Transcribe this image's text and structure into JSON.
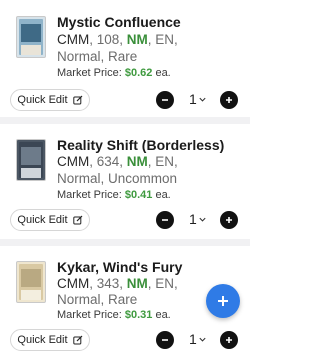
{
  "items": [
    {
      "name": "Mystic Confluence",
      "set": "CMM",
      "number": ", 108, ",
      "condition": "NM",
      "details1_tail": ", EN,",
      "details2": "Normal, Rare",
      "price_label": "Market Price: ",
      "price_value": "$0.62",
      "price_unit": " ea.",
      "quick_edit": "Quick Edit",
      "qty": "1",
      "thumb": {
        "frame": "#8fb3c9",
        "art": "#3f6a86"
      }
    },
    {
      "name": "Reality Shift (Borderless)",
      "set": "CMM",
      "number": ", 634, ",
      "condition": "NM",
      "details1_tail": ", EN,",
      "details2": "Normal, Uncommon",
      "price_label": "Market Price: ",
      "price_value": "$0.41",
      "price_unit": " ea.",
      "quick_edit": "Quick Edit",
      "qty": "1",
      "thumb": {
        "frame": "#3b4654",
        "art": "#6d7b8a"
      }
    },
    {
      "name": "Kykar, Wind's Fury",
      "set": "CMM",
      "number": ", 343, ",
      "condition": "NM",
      "details1_tail": ", EN,",
      "details2": "Normal, Rare",
      "price_label": "Market Price: ",
      "price_value": "$0.31",
      "price_unit": " ea.",
      "quick_edit": "Quick Edit",
      "qty": "1",
      "thumb": {
        "frame": "#d9c9a3",
        "art": "#b9a982"
      }
    }
  ],
  "icons": {
    "edit": "pencil-square-icon",
    "minus": "minus-circle-icon",
    "plus": "plus-circle-icon",
    "chevron": "chevron-down-icon",
    "fab": "add-fab-icon"
  },
  "colors": {
    "accent": "#2f7be6",
    "price_green": "#3f9a3f"
  }
}
